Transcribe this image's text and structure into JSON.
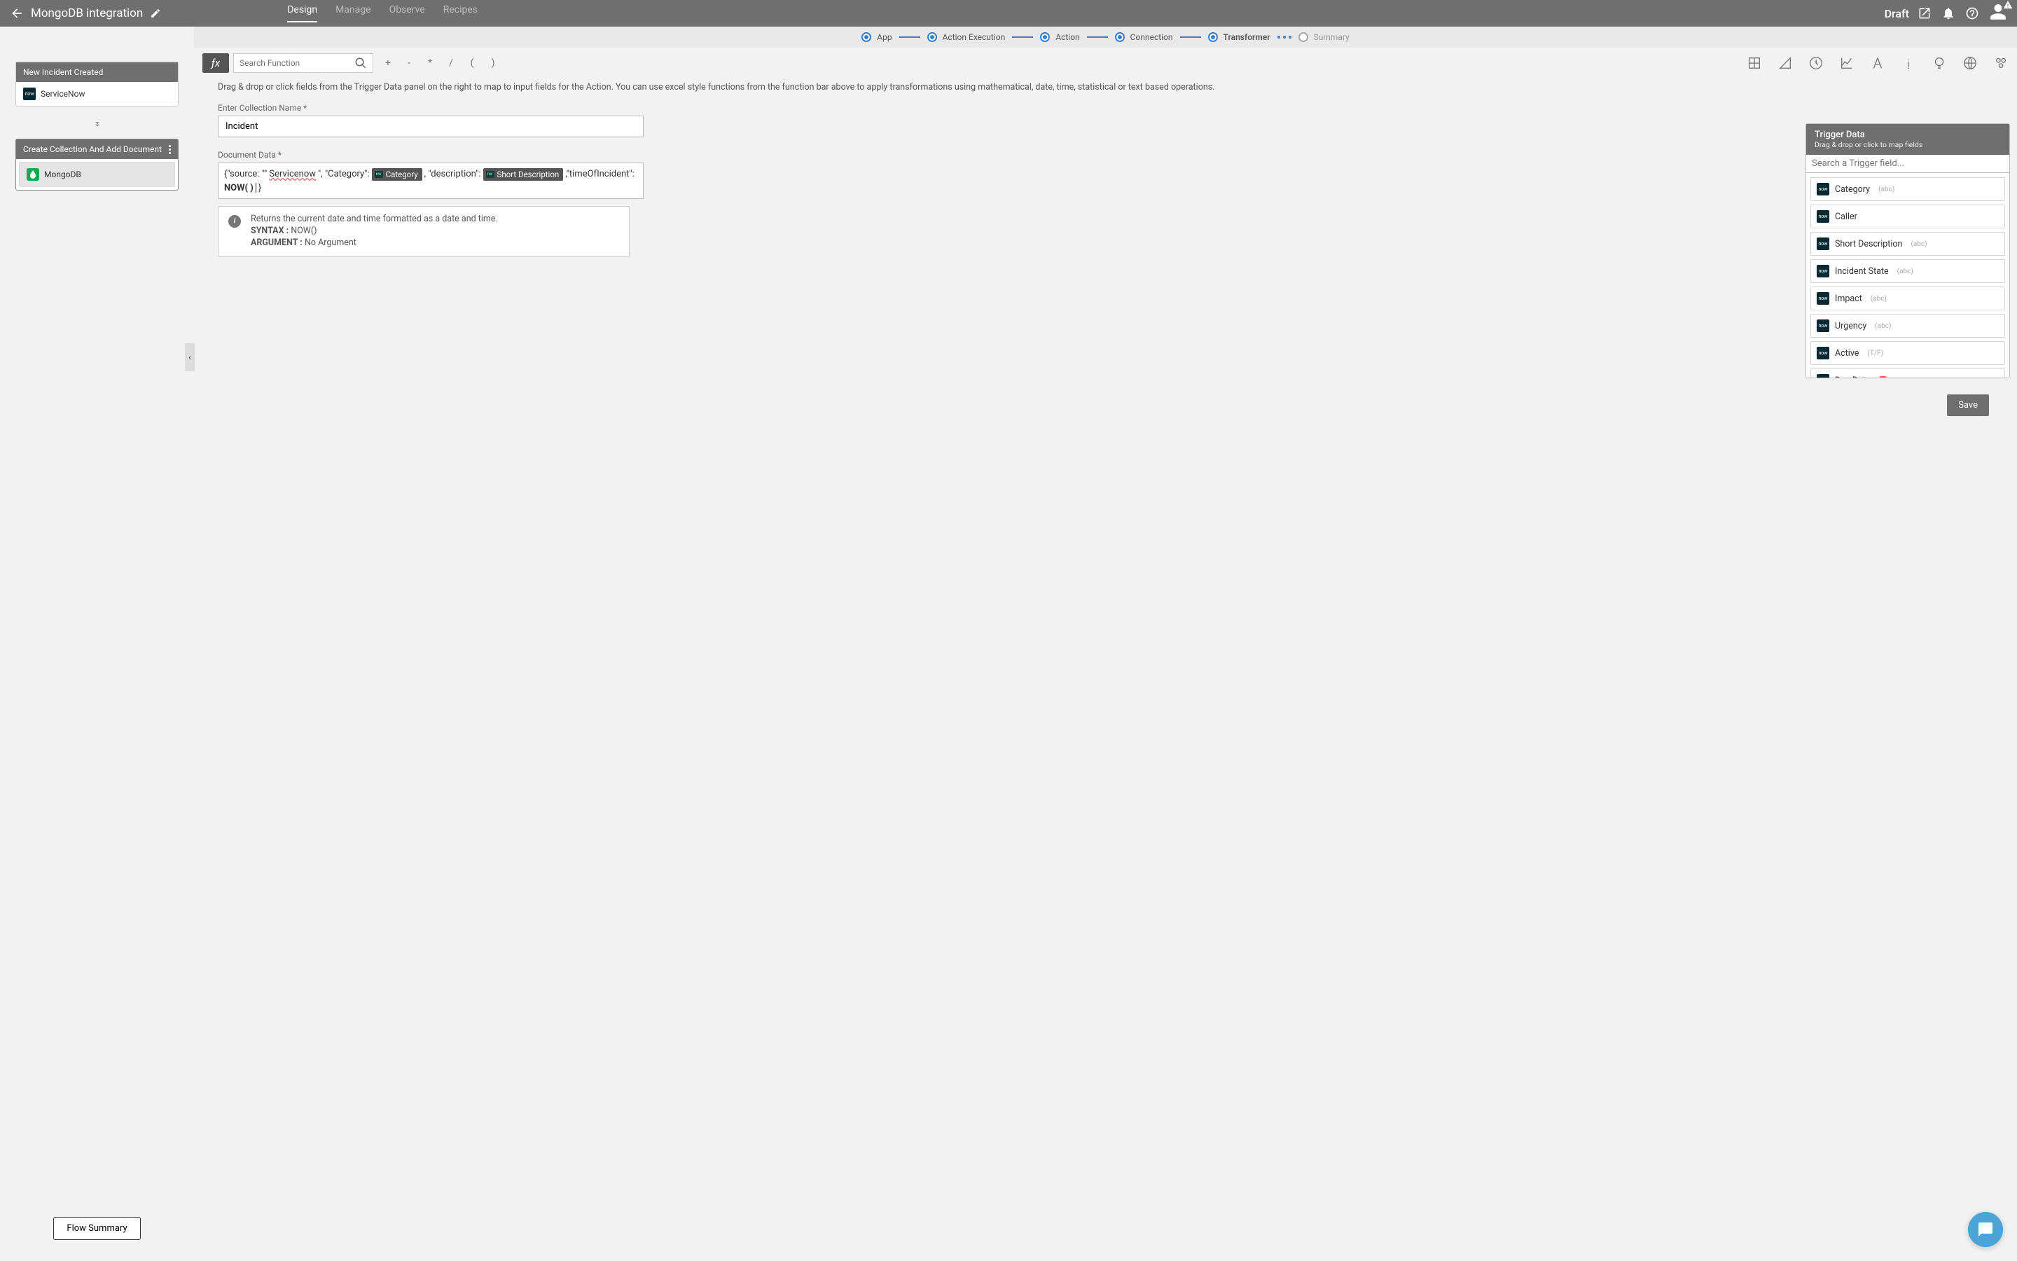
{
  "header": {
    "title": "MongoDB integration",
    "nav": [
      "Design",
      "Manage",
      "Observe",
      "Recipes"
    ],
    "active_nav": "Design",
    "status": "Draft"
  },
  "wizard": {
    "steps": [
      "App",
      "Action Execution",
      "Action",
      "Connection",
      "Transformer",
      "Summary"
    ],
    "active": "Transformer"
  },
  "sidebar": {
    "trigger_card": {
      "title": "New Incident Created",
      "app": "ServiceNow"
    },
    "action_card": {
      "title": "Create Collection And Add Document",
      "app": "MongoDB"
    },
    "flow_summary_btn": "Flow Summary"
  },
  "fnbar": {
    "search_placeholder": "Search Function",
    "ops": [
      "+",
      "-",
      "*",
      "/",
      "(",
      ")"
    ]
  },
  "instructions": "Drag & drop or click fields from the Trigger Data panel on the right to map to input fields for the Action. You can use excel style functions from the function bar above to apply transformations using mathematical, date, time, statistical or text based operations.",
  "form": {
    "collection_label": "Enter Collection Name *",
    "collection_value": "Incident",
    "doc_label": "Document Data *",
    "doc_pre1": "{\"source: \"\"",
    "doc_wavy": "Servicenow",
    "doc_post1": "\", \"Category\": ",
    "chip1": "Category",
    "doc_post2": " , \"description\": ",
    "chip2": "Short Description",
    "doc_post3": " ,\"timeOfIncident\":",
    "now_fn": "NOW( )",
    "doc_post4": "}"
  },
  "hint": {
    "returns": "Returns the current date and time formatted as a date and time.",
    "syntax_label": "SYNTAX :",
    "syntax_val": "NOW()",
    "arg_label": "ARGUMENT :",
    "arg_val": "No Argument"
  },
  "trigger_panel": {
    "title": "Trigger Data",
    "subtitle": "Drag & drop or click to map fields",
    "search_placeholder": "Search a Trigger field...",
    "fields": [
      {
        "name": "Category",
        "type": "(abc)"
      },
      {
        "name": "Caller",
        "type": ""
      },
      {
        "name": "Short Description",
        "type": "(abc)"
      },
      {
        "name": "Incident State",
        "type": "(abc)"
      },
      {
        "name": "Impact",
        "type": "(abc)"
      },
      {
        "name": "Urgency",
        "type": "(abc)"
      },
      {
        "name": "Active",
        "type": "(T/F)"
      },
      {
        "name": "Due Date",
        "type": "📅"
      }
    ]
  },
  "save_btn": "Save"
}
